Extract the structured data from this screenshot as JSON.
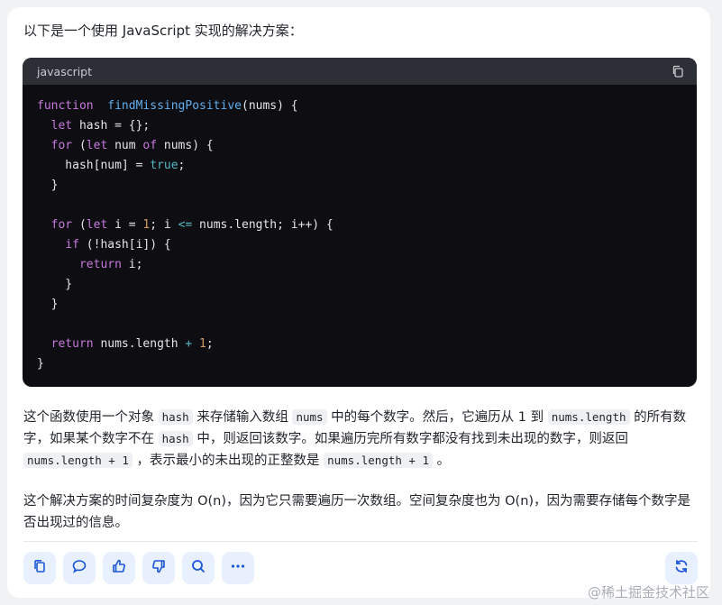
{
  "intro": "以下是一个使用 JavaScript 实现的解决方案：",
  "code": {
    "language": "javascript",
    "lines": [
      {
        "segs": [
          [
            "kw",
            "function"
          ],
          [
            "",
            "  "
          ],
          [
            "fn",
            "findMissingPositive"
          ],
          [
            "",
            "(nums) {"
          ]
        ]
      },
      {
        "segs": [
          [
            "",
            "  "
          ],
          [
            "kw",
            "let"
          ],
          [
            "",
            " hash = {};"
          ]
        ]
      },
      {
        "segs": [
          [
            "",
            "  "
          ],
          [
            "kw",
            "for"
          ],
          [
            "",
            " ("
          ],
          [
            "kw",
            "let"
          ],
          [
            "",
            " num "
          ],
          [
            "kw",
            "of"
          ],
          [
            "",
            " nums) {"
          ]
        ]
      },
      {
        "segs": [
          [
            "",
            "    hash[num] = "
          ],
          [
            "bool",
            "true"
          ],
          [
            "",
            ";"
          ]
        ]
      },
      {
        "segs": [
          [
            "",
            "  }"
          ]
        ]
      },
      {
        "segs": [
          [
            "",
            ""
          ]
        ]
      },
      {
        "segs": [
          [
            "",
            "  "
          ],
          [
            "kw",
            "for"
          ],
          [
            "",
            " ("
          ],
          [
            "kw",
            "let"
          ],
          [
            "",
            " i = "
          ],
          [
            "num",
            "1"
          ],
          [
            "",
            "; i "
          ],
          [
            "op",
            "<="
          ],
          [
            "",
            " nums.length; i++) {"
          ]
        ]
      },
      {
        "segs": [
          [
            "",
            "    "
          ],
          [
            "kw",
            "if"
          ],
          [
            "",
            " (!hash[i]) {"
          ]
        ]
      },
      {
        "segs": [
          [
            "",
            "      "
          ],
          [
            "kw",
            "return"
          ],
          [
            "",
            " i;"
          ]
        ]
      },
      {
        "segs": [
          [
            "",
            "    }"
          ]
        ]
      },
      {
        "segs": [
          [
            "",
            "  }"
          ]
        ]
      },
      {
        "segs": [
          [
            "",
            ""
          ]
        ]
      },
      {
        "segs": [
          [
            "",
            "  "
          ],
          [
            "kw",
            "return"
          ],
          [
            "",
            " nums.length "
          ],
          [
            "op",
            "+"
          ],
          [
            "",
            " "
          ],
          [
            "num",
            "1"
          ],
          [
            "",
            ";"
          ]
        ]
      },
      {
        "segs": [
          [
            "",
            "}"
          ]
        ]
      }
    ]
  },
  "paragraph1": {
    "segments": [
      [
        "t",
        "这个函数使用一个对象 "
      ],
      [
        "c",
        "hash"
      ],
      [
        "t",
        " 来存储输入数组 "
      ],
      [
        "c",
        "nums"
      ],
      [
        "t",
        " 中的每个数字。然后，它遍历从 1 到 "
      ],
      [
        "c",
        "nums.length"
      ],
      [
        "t",
        " 的所有数字，如果某个数字不在 "
      ],
      [
        "c",
        "hash"
      ],
      [
        "t",
        " 中，则返回该数字。如果遍历完所有数字都没有找到未出现的数字，则返回 "
      ],
      [
        "c",
        "nums.length + 1"
      ],
      [
        "t",
        " ，表示最小的未出现的正整数是 "
      ],
      [
        "c",
        "nums.length + 1"
      ],
      [
        "t",
        " 。"
      ]
    ]
  },
  "paragraph2": "这个解决方案的时间复杂度为 O(n)，因为它只需要遍历一次数组。空间复杂度也为 O(n)，因为需要存储每个数字是否出现过的信息。",
  "actions": [
    {
      "name": "copy-button",
      "icon": "copy-icon"
    },
    {
      "name": "comment-button",
      "icon": "comment-icon"
    },
    {
      "name": "thumbs-up-button",
      "icon": "thumbs-up-icon"
    },
    {
      "name": "thumbs-down-button",
      "icon": "thumbs-down-icon"
    },
    {
      "name": "search-button",
      "icon": "search-icon"
    },
    {
      "name": "more-button",
      "icon": "more-icon"
    }
  ],
  "refresh_icon": "refresh-icon",
  "watermark": "@稀土掘金技术社区",
  "colors": {
    "accent": "#1a56d6",
    "action_bg": "#e8f0fe",
    "code_bg": "#0d0d12",
    "code_header_bg": "#2d2f36",
    "keyword": "#c678dd",
    "function": "#61afef"
  }
}
